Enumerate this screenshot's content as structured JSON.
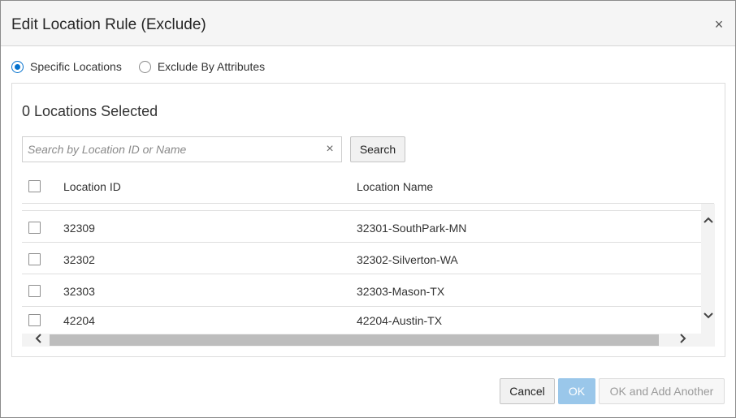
{
  "dialog": {
    "title": "Edit Location Rule (Exclude)",
    "close_glyph": "×"
  },
  "mode": {
    "options": [
      {
        "label": "Specific Locations",
        "selected": true
      },
      {
        "label": "Exclude By Attributes",
        "selected": false
      }
    ]
  },
  "selection": {
    "count_text": "0 Locations Selected"
  },
  "search": {
    "placeholder": "Search by Location ID or Name",
    "value": "",
    "clear_glyph": "×",
    "button_label": "Search"
  },
  "table": {
    "columns": [
      "Location ID",
      "Location Name"
    ],
    "rows": [
      {
        "id": "32309",
        "name": "32301-SouthPark-MN",
        "checked": false
      },
      {
        "id": "32302",
        "name": "32302-Silverton-WA",
        "checked": false
      },
      {
        "id": "32303",
        "name": "32303-Mason-TX",
        "checked": false
      },
      {
        "id": "42204",
        "name": "42204-Austin-TX",
        "checked": false
      }
    ]
  },
  "scroll": {
    "up_glyph": "⌃",
    "down_glyph": "⌄",
    "left_glyph": "<",
    "right_glyph": ">"
  },
  "footer": {
    "cancel_label": "Cancel",
    "ok_label": "OK",
    "ok_add_label": "OK and Add Another"
  },
  "colors": {
    "accent": "#0572ce",
    "ok_disabled": "#9ac7ea"
  }
}
